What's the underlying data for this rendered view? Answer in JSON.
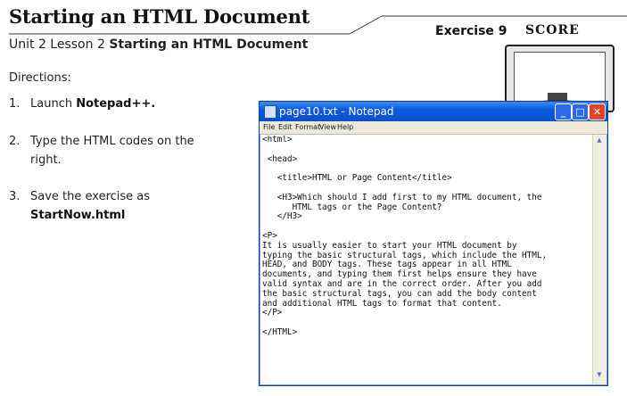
{
  "header": {
    "title": "Starting an HTML Document",
    "subtitle_prefix": "Unit 2 Lesson 2 ",
    "subtitle_bold": "Starting an HTML Document",
    "exercise": "Exercise 9",
    "score": "SCORE"
  },
  "directions": {
    "heading": "Directions:",
    "steps": [
      {
        "num": "1.",
        "text": "Launch ",
        "bold": "Notepad++."
      },
      {
        "num": "2.",
        "line1": "Type the HTML codes on the",
        "line2": "right."
      },
      {
        "num": "3.",
        "line1": "Save the exercise as",
        "bold": "StartNow.html"
      }
    ]
  },
  "notepad": {
    "title": "page10.txt - Notepad",
    "menu": [
      "File",
      "Edit",
      "Format",
      "View",
      "Help"
    ],
    "content": "<html>\n\n <head>\n\n   <title>HTML or Page Content</title>\n\n   <H3>Which should I add first to my HTML document, the\n      HTML tags or the Page Content?\n   </H3>\n\n<P>\nIt is usually easier to start your HTML document by\ntyping the basic structural tags, which include the HTML,\nHEAD, and BODY tags. These tags appear in all HTML\ndocuments, and typing them first helps ensure they have\nvalid syntax and are in the correct order. After you add\nthe basic structural tags, you can add the body content\nand additional HTML tags to format that content.\n</P>\n\n</HTML>"
  }
}
